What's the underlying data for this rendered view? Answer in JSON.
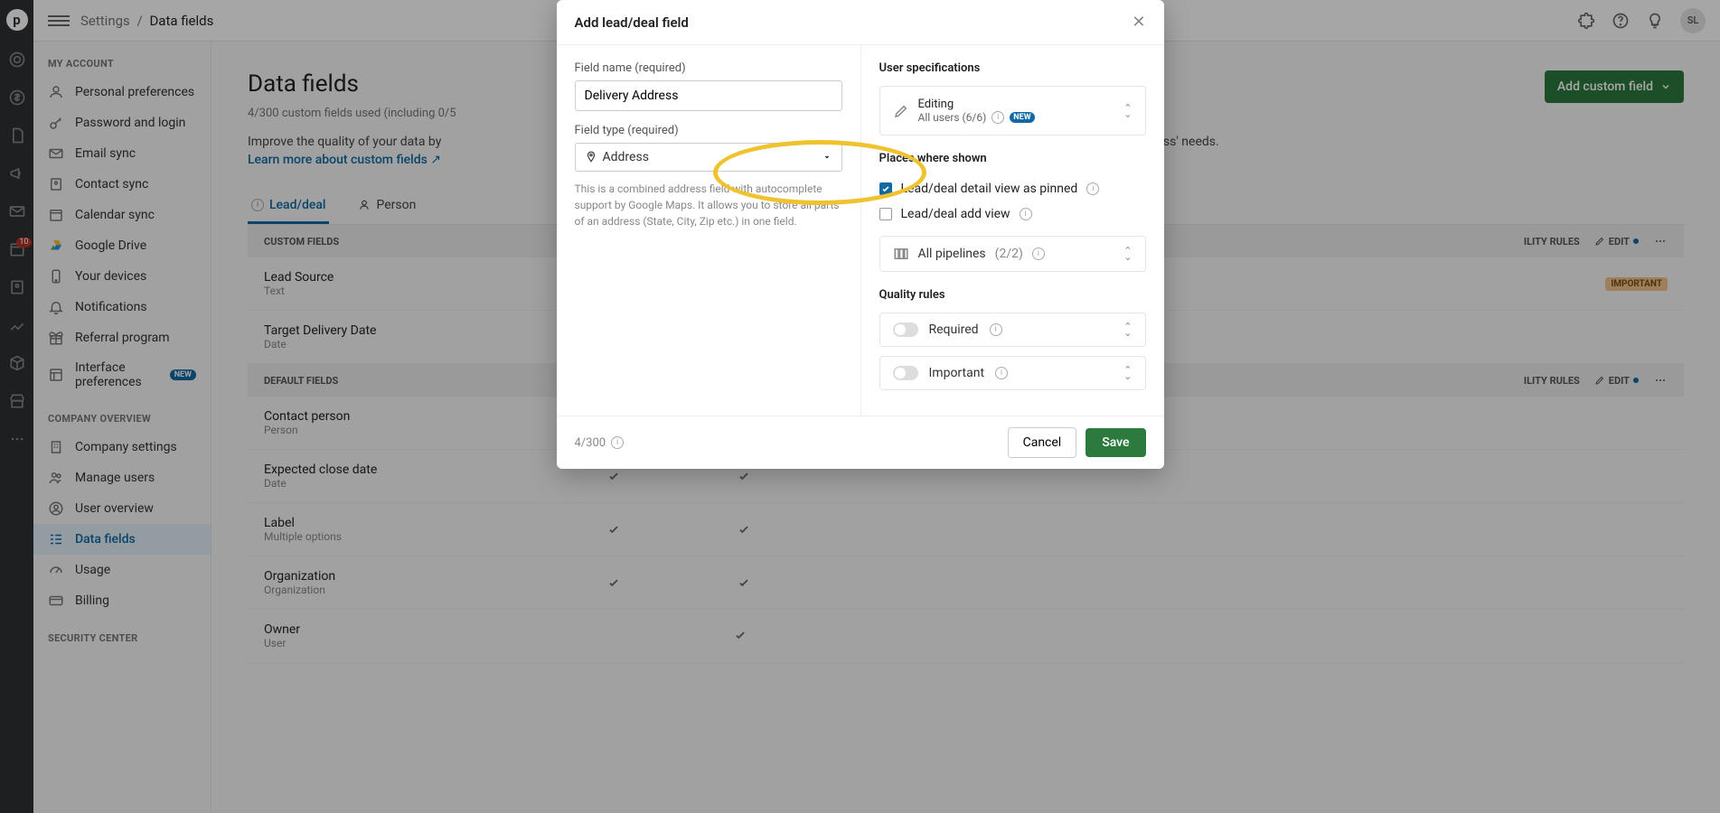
{
  "topbar": {
    "breadcrumb_root": "Settings",
    "breadcrumb_current": "Data fields",
    "avatar": "SL"
  },
  "sidebar": {
    "sections": {
      "my_account": "MY ACCOUNT",
      "company_overview": "COMPANY OVERVIEW",
      "security_center": "SECURITY CENTER"
    },
    "items": {
      "personal_prefs": "Personal preferences",
      "password_login": "Password and login",
      "email_sync": "Email sync",
      "contact_sync": "Contact sync",
      "calendar_sync": "Calendar sync",
      "google_drive": "Google Drive",
      "your_devices": "Your devices",
      "notifications": "Notifications",
      "referral": "Referral program",
      "interface_prefs": "Interface preferences",
      "company_settings": "Company settings",
      "manage_users": "Manage users",
      "user_overview": "User overview",
      "data_fields": "Data fields",
      "usage": "Usage",
      "billing": "Billing"
    },
    "new_pill": "NEW"
  },
  "rail": {
    "badge": "10"
  },
  "main": {
    "title": "Data fields",
    "meta": "4/300 custom fields used (including 0/5",
    "desc": "Improve the quality of your data by",
    "desc_tail": "or data to your business' needs.",
    "learn_link": "Learn more about custom fields",
    "add_btn": "Add custom field",
    "tabs": {
      "lead_deal": "Lead/deal",
      "person": "Person"
    },
    "section_custom": "CUSTOM FIELDS",
    "section_default": "DEFAULT FIELDS",
    "quality_rules": "ILITY RULES",
    "edit": "EDIT",
    "custom_fields": [
      {
        "name": "Lead Source",
        "type": "Text",
        "badge": "IMPORTANT"
      },
      {
        "name": "Target Delivery Date",
        "type": "Date"
      }
    ],
    "default_fields": [
      {
        "name": "Contact person",
        "type": "Person",
        "c1": true,
        "c2": true
      },
      {
        "name": "Expected close date",
        "type": "Date",
        "c1": true,
        "c2": true
      },
      {
        "name": "Label",
        "type": "Multiple options",
        "c1": true,
        "c2": true
      },
      {
        "name": "Organization",
        "type": "Organization",
        "c1": true,
        "c2": true
      },
      {
        "name": "Owner",
        "type": "User",
        "c1": false,
        "c2": true
      }
    ]
  },
  "modal": {
    "title": "Add lead/deal field",
    "field_name_label": "Field name (required)",
    "field_name_value": "Delivery Address",
    "field_type_label": "Field type (required)",
    "field_type_value": "Address",
    "help_text": "This is a combined address field with autocomplete support by Google Maps. It allows you to store all parts of an address (State, City, Zip etc.) in one field.",
    "user_spec_title": "User specifications",
    "editing_label": "Editing",
    "editing_sub": "All users (6/6)",
    "new_pill": "NEW",
    "places_title": "Places where shown",
    "place_pinned": "Lead/deal detail view as pinned",
    "place_add": "Lead/deal add view",
    "pipelines": "All pipelines",
    "pipelines_count": "(2/2)",
    "quality_title": "Quality rules",
    "required_label": "Required",
    "important_label": "Important",
    "footer_count": "4/300",
    "cancel": "Cancel",
    "save": "Save"
  }
}
